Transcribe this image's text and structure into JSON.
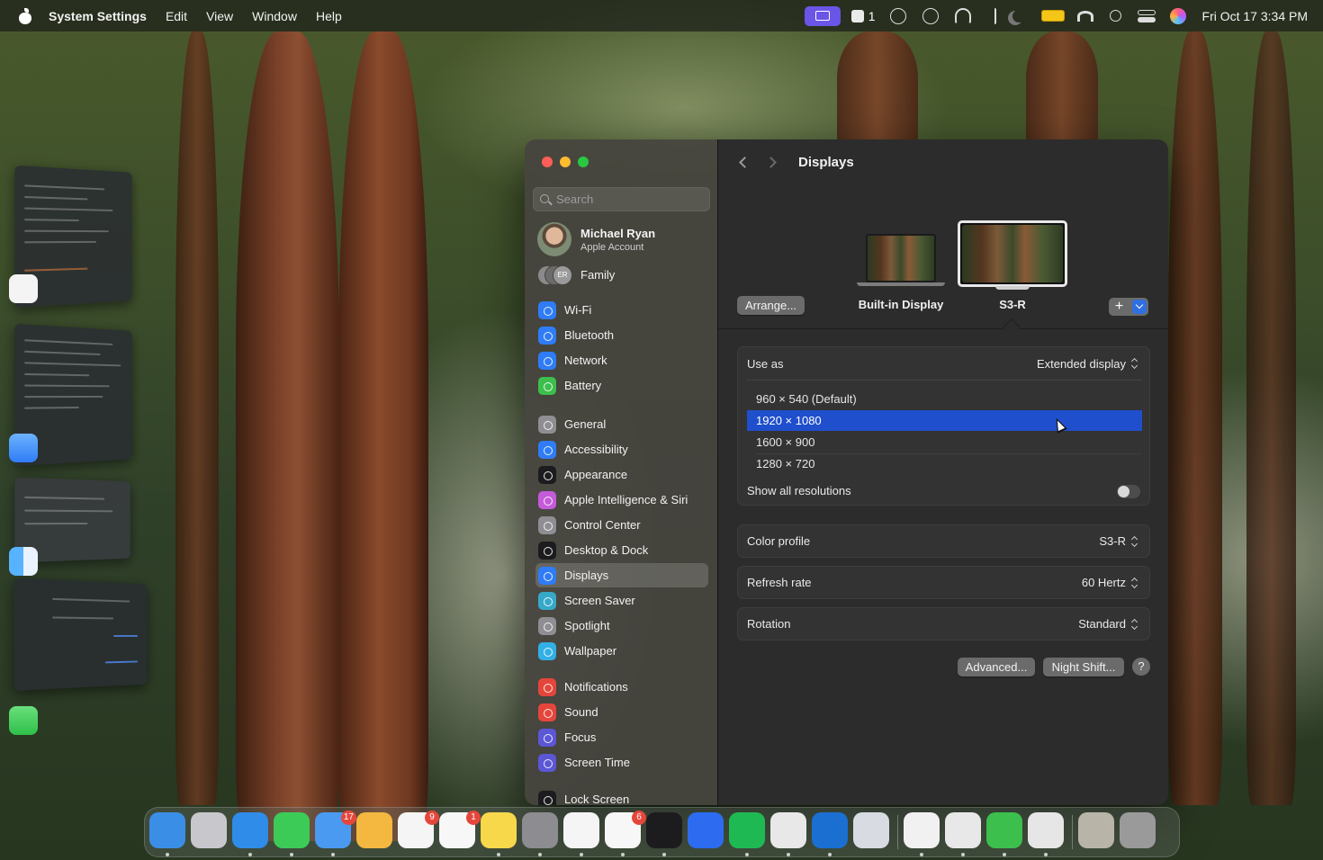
{
  "menubar": {
    "app_name": "System Settings",
    "menus": [
      "Edit",
      "View",
      "Window",
      "Help"
    ],
    "stage_count": "1",
    "clock": "Fri Oct 17  3:34 PM"
  },
  "window": {
    "title": "Displays",
    "search_placeholder": "Search",
    "account": {
      "name": "Michael Ryan",
      "subtitle": "Apple Account"
    },
    "family": {
      "label": "Family",
      "initials": "ER"
    },
    "sidebar_groups": [
      [
        {
          "label": "Wi-Fi",
          "icon": "wifi-icon",
          "color": "#2f7cf6"
        },
        {
          "label": "Bluetooth",
          "icon": "bluetooth-icon",
          "color": "#2f7cf6"
        },
        {
          "label": "Network",
          "icon": "network-globe-icon",
          "color": "#2f7cf6"
        },
        {
          "label": "Battery",
          "icon": "battery-icon",
          "color": "#3cbf4c"
        }
      ],
      [
        {
          "label": "General",
          "icon": "gear-icon",
          "color": "#8e8e93"
        },
        {
          "label": "Accessibility",
          "icon": "accessibility-icon",
          "color": "#2f7cf6"
        },
        {
          "label": "Appearance",
          "icon": "appearance-icon",
          "color": "#1c1c1e"
        },
        {
          "label": "Apple Intelligence & Siri",
          "icon": "siri-icon",
          "color": "#c45bd8"
        },
        {
          "label": "Control Center",
          "icon": "control-center-icon",
          "color": "#8e8e93"
        },
        {
          "label": "Desktop & Dock",
          "icon": "desktop-dock-icon",
          "color": "#1c1c1e"
        },
        {
          "label": "Displays",
          "icon": "displays-sun-icon",
          "color": "#2f7cf6",
          "selected": true
        },
        {
          "label": "Screen Saver",
          "icon": "screen-saver-icon",
          "color": "#36a9c9"
        },
        {
          "label": "Spotlight",
          "icon": "spotlight-magnifier-icon",
          "color": "#8e8e93"
        },
        {
          "label": "Wallpaper",
          "icon": "wallpaper-flower-icon",
          "color": "#32b0e6"
        }
      ],
      [
        {
          "label": "Notifications",
          "icon": "notifications-bell-icon",
          "color": "#e5463b"
        },
        {
          "label": "Sound",
          "icon": "sound-speaker-icon",
          "color": "#e5463b"
        },
        {
          "label": "Focus",
          "icon": "focus-moon-icon",
          "color": "#5b57d6"
        },
        {
          "label": "Screen Time",
          "icon": "screen-time-hourglass-icon",
          "color": "#5b57d6"
        }
      ],
      [
        {
          "label": "Lock Screen",
          "icon": "lock-icon",
          "color": "#1c1c1e"
        }
      ]
    ]
  },
  "displays": {
    "arrange_label": "Arrange...",
    "builtin_label": "Built-in Display",
    "external_label": "S3-R",
    "add_label": "+",
    "use_as": {
      "label": "Use as",
      "value": "Extended display"
    },
    "resolutions": [
      {
        "label": "960 × 540 (Default)",
        "selected": false
      },
      {
        "label": "1920 × 1080",
        "selected": true
      },
      {
        "label": "1600 × 900",
        "selected": false
      },
      {
        "label": "1280 × 720",
        "selected": false
      }
    ],
    "show_all": {
      "label": "Show all resolutions",
      "on": false
    },
    "color_profile": {
      "label": "Color profile",
      "value": "S3-R"
    },
    "refresh_rate": {
      "label": "Refresh rate",
      "value": "60 Hertz"
    },
    "rotation": {
      "label": "Rotation",
      "value": "Standard"
    },
    "advanced_label": "Advanced...",
    "night_shift_label": "Night Shift...",
    "help_label": "?"
  },
  "dock": {
    "apps": [
      {
        "name": "finder-icon",
        "color": "#3a8ee6",
        "running": true
      },
      {
        "name": "launchpad-icon",
        "color": "#c7c7cc",
        "running": false
      },
      {
        "name": "safari-icon",
        "color": "#2f8ce8",
        "running": true
      },
      {
        "name": "messages-icon",
        "color": "#3dcb58",
        "running": true
      },
      {
        "name": "mail-icon",
        "color": "#4a9af2",
        "badge": "17",
        "running": true
      },
      {
        "name": "photos-icon",
        "color": "#f4b740",
        "running": false
      },
      {
        "name": "calendar-icon",
        "color": "#f5f5f5",
        "badge": "9",
        "running": false
      },
      {
        "name": "reminders-icon",
        "color": "#f7f7f7",
        "badge": "1",
        "running": false
      },
      {
        "name": "notes-icon",
        "color": "#f6d84a",
        "running": true
      },
      {
        "name": "system-settings-icon",
        "color": "#8c8c91",
        "running": true
      },
      {
        "name": "chatgpt-icon",
        "color": "#f5f5f5",
        "running": true
      },
      {
        "name": "slack-icon",
        "color": "#f7f7f7",
        "badge": "6",
        "running": true
      },
      {
        "name": "terminal-icon",
        "color": "#1c1c1e",
        "running": true
      },
      {
        "name": "zoom-icon",
        "color": "#2d6cf0",
        "running": false
      },
      {
        "name": "spotify-icon",
        "color": "#1fb954",
        "running": true
      },
      {
        "name": "cube-app-icon",
        "color": "#e8e8e8",
        "running": true
      },
      {
        "name": "outlook-icon",
        "color": "#1a6fd1",
        "running": true
      },
      {
        "name": "iphone-mirroring-icon",
        "color": "#d8dbe2",
        "running": false
      },
      {
        "name": "chrome-icon",
        "color": "#f1f1f1",
        "running": true
      },
      {
        "name": "zotero-icon",
        "color": "#e8e8e8",
        "running": true
      },
      {
        "name": "numbers-icon",
        "color": "#3cbf4c",
        "running": true
      },
      {
        "name": "keychain-access-icon",
        "color": "#e6e6e6",
        "running": true
      },
      {
        "name": "archive-utility-icon",
        "color": "#b9b4a8",
        "running": false
      },
      {
        "name": "trash-icon",
        "color": "#9a9a9a",
        "running": false
      }
    ]
  }
}
